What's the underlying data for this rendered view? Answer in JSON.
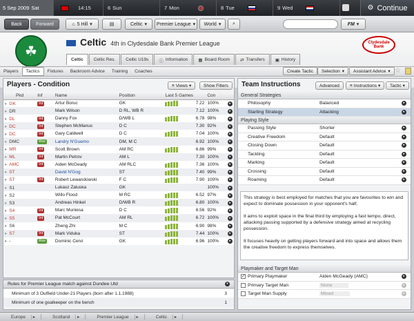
{
  "datebar": {
    "date": "5 Sep 2009",
    "day": "Sat",
    "time": "14:15",
    "days": [
      {
        "num": "6",
        "name": "Sun"
      },
      {
        "num": "7",
        "name": "Mon"
      },
      {
        "num": "8",
        "name": "Tue"
      },
      {
        "num": "9",
        "name": "Wed"
      }
    ],
    "continue_label": "Continue"
  },
  "nav": {
    "back": "Back",
    "forward": "Forward",
    "home": "5 Hill",
    "club": "Celtic",
    "league": "Premier League",
    "world": "World",
    "fm": "FM"
  },
  "header": {
    "club_name": "Celtic",
    "position_text": "4th in Clydesdale Bank Premier League",
    "sponsor": "Clydesdale Bank"
  },
  "tabs": [
    {
      "label": "Celtic",
      "active": true
    },
    {
      "label": "Celtic Res.",
      "active": false
    },
    {
      "label": "Celtic U19s",
      "active": false
    },
    {
      "label": "Information",
      "active": false
    },
    {
      "label": "Board Room",
      "active": false
    },
    {
      "label": "Transfers",
      "active": false
    },
    {
      "label": "History",
      "active": false
    }
  ],
  "subtabs": [
    {
      "label": "Players",
      "active": false
    },
    {
      "label": "Tactics",
      "active": true
    },
    {
      "label": "Fixtures",
      "active": false
    },
    {
      "label": "Backroom Advice",
      "active": false
    },
    {
      "label": "Training",
      "active": false
    },
    {
      "label": "Coaches",
      "active": false
    }
  ],
  "subtab_buttons": {
    "create_tactic": "Create Tactic",
    "selection": "Selection",
    "assistant_advice": "Assistant Advice"
  },
  "players_panel": {
    "title": "Players - Condition",
    "views": "Views",
    "show_filters": "Show Filters",
    "columns": [
      "Pkd",
      "Inf",
      "Name",
      "Position",
      "Last 5 Games",
      "Con"
    ],
    "rows": [
      {
        "pkd": "GK",
        "red": true,
        "inf": "Int",
        "inf_color": "#b03030",
        "name": "Artur Boruc",
        "pos": "GK",
        "bars": [
          6,
          7,
          7,
          8,
          8
        ],
        "rating": "7.22",
        "con": "100%"
      },
      {
        "pkd": "DR",
        "red": false,
        "inf": "",
        "inf_color": "",
        "name": "Mark Wilson",
        "pos": "D RL, WB R",
        "bars": [],
        "rating": "7.12",
        "con": "100%"
      },
      {
        "pkd": "DL",
        "red": true,
        "inf": "Int",
        "inf_color": "#b03030",
        "name": "Danny Fox",
        "pos": "D/WB L",
        "bars": [
          6,
          7,
          8,
          8,
          8
        ],
        "rating": "6.78",
        "con": "98%"
      },
      {
        "pkd": "DC",
        "red": true,
        "inf": "Int",
        "inf_color": "#b03030",
        "name": "Stephen McManus",
        "pos": "D C",
        "bars": [],
        "rating": "7.30",
        "con": "92%"
      },
      {
        "pkd": "DC",
        "red": true,
        "inf": "Int",
        "inf_color": "#b03030",
        "name": "Gary Caldwell",
        "pos": "D C",
        "bars": [
          6,
          7,
          8,
          8,
          8
        ],
        "rating": "7.04",
        "con": "100%"
      },
      {
        "pkd": "DMC",
        "red": false,
        "inf": "Rsv",
        "inf_color": "#5a9a3a",
        "name": "Landry N'Guemo",
        "pos": "DM, M C",
        "bars": [],
        "rating": "6.92",
        "con": "100%",
        "blue": true
      },
      {
        "pkd": "MR",
        "red": true,
        "inf": "Int",
        "inf_color": "#b03030",
        "name": "Scott Brown",
        "pos": "AM RC",
        "bars": [
          6,
          7,
          8,
          8,
          8
        ],
        "rating": "6.86",
        "con": "99%"
      },
      {
        "pkd": "ML",
        "red": true,
        "inf": "Int",
        "inf_color": "#b03030",
        "name": "Martin Petrov",
        "pos": "AM L",
        "bars": [],
        "rating": "7.30",
        "con": "100%"
      },
      {
        "pkd": "AMC",
        "red": true,
        "inf": "Int",
        "inf_color": "#b03030",
        "name": "Aiden McGeady",
        "pos": "AM RLC",
        "bars": [
          6,
          7,
          8,
          8,
          8
        ],
        "rating": "7.36",
        "con": "100%"
      },
      {
        "pkd": "ST",
        "red": true,
        "inf": "",
        "inf_color": "",
        "name": "David N'Gog",
        "pos": "ST",
        "bars": [
          6,
          7,
          8,
          8,
          8
        ],
        "rating": "7.40",
        "con": "99%",
        "blue": true
      },
      {
        "pkd": "ST",
        "red": true,
        "inf": "Int",
        "inf_color": "#b03030",
        "name": "Robert Lewandowski",
        "pos": "F C",
        "bars": [
          6,
          7,
          8,
          8,
          8
        ],
        "rating": "7.90",
        "con": "100%"
      },
      {
        "pkd": "S1",
        "red": false,
        "inf": "",
        "inf_color": "",
        "name": "Lukasz Zaluska",
        "pos": "GK",
        "bars": [],
        "rating": "",
        "con": "100%"
      },
      {
        "pkd": "S2",
        "red": false,
        "inf": "",
        "inf_color": "",
        "name": "Willo Flood",
        "pos": "M RC",
        "bars": [
          6,
          7,
          8,
          8,
          8
        ],
        "rating": "6.52",
        "con": "97%"
      },
      {
        "pkd": "S3",
        "red": false,
        "inf": "",
        "inf_color": "",
        "name": "Andreas Hinkel",
        "pos": "D/WB R",
        "bars": [
          6,
          7,
          8,
          8,
          8
        ],
        "rating": "6.80",
        "con": "100%"
      },
      {
        "pkd": "S4",
        "red": true,
        "inf": "Int",
        "inf_color": "#b03030",
        "name": "Marc Muniesa",
        "pos": "D C",
        "bars": [
          6,
          7,
          8,
          8,
          8
        ],
        "rating": "6.56",
        "con": "92%"
      },
      {
        "pkd": "S5",
        "red": true,
        "inf": "Int",
        "inf_color": "#b03030",
        "name": "Pat McCourt",
        "pos": "AM RL",
        "bars": [
          6,
          7,
          8,
          8,
          8
        ],
        "rating": "6.72",
        "con": "100%"
      },
      {
        "pkd": "S6",
        "red": false,
        "inf": "",
        "inf_color": "",
        "name": "Zheng Zhi",
        "pos": "M C",
        "bars": [
          6,
          7,
          8,
          8,
          8
        ],
        "rating": "6.90",
        "con": "98%"
      },
      {
        "pkd": "S7",
        "red": true,
        "inf": "Int",
        "inf_color": "#b03030",
        "name": "Mark Viduka",
        "pos": "ST",
        "bars": [
          6,
          7,
          8,
          8,
          8
        ],
        "rating": "7.44",
        "con": "100%"
      },
      {
        "pkd": "-",
        "red": false,
        "inf": "Rsv",
        "inf_color": "#5a9a3a",
        "name": "Dominic Cervi",
        "pos": "GK",
        "bars": [
          6,
          7,
          8,
          8,
          8
        ],
        "rating": "6.96",
        "con": "100%"
      }
    ]
  },
  "rules_panel": {
    "title": "Rules for Premier League match against Dundee Utd",
    "rows": [
      {
        "text": "Minimum of 3 Outfield Under-21 Players (born after 1.1.1988)",
        "count": "3"
      },
      {
        "text": "Minimum of one goalkeeper on the bench",
        "count": "1"
      }
    ]
  },
  "team_panel": {
    "title": "Team Instructions",
    "advanced": "Advanced",
    "instructions": "Instructions",
    "tactic": "Tactic",
    "general_header": "General Strategies",
    "general": [
      {
        "label": "Philosophy",
        "value": "Balanced",
        "hl": false
      },
      {
        "label": "Starting Strategy",
        "value": "Attacking",
        "hl": true
      }
    ],
    "playing_header": "Playing Style",
    "playing": [
      {
        "label": "Passing Style",
        "value": "Shorter"
      },
      {
        "label": "Creative Freedom",
        "value": "Default"
      },
      {
        "label": "Closing Down",
        "value": "Default"
      },
      {
        "label": "Tackling",
        "value": "Default"
      },
      {
        "label": "Marking",
        "value": "Default"
      },
      {
        "label": "Crossing",
        "value": "Default"
      },
      {
        "label": "Roaming",
        "value": "Default"
      }
    ],
    "description": [
      "This strategy is best employed for matches that you are favourites to win and expect to dominate possession in your opponent's half.",
      "It aims to exploit space in the final third by employing a fast tempo, direct, attacking passing supported by a defensive strategy aimed at recycling possession.",
      "It focuses heavily on getting players forward and into space and allows them the creative freedom to express themselves."
    ],
    "playmaker_header": "Playmaker and Target Man",
    "playmaker": [
      {
        "label": "Primary Playmaker",
        "value": "Aiden McGeady (AMC)",
        "checked": true
      },
      {
        "label": "Primary Target Man",
        "value": "None",
        "checked": false
      },
      {
        "label": "Target Man Supply",
        "value": "Mixed",
        "checked": false
      }
    ]
  },
  "statusbar": [
    "Europe",
    "Scotland",
    "Premier League",
    "Celtic"
  ]
}
